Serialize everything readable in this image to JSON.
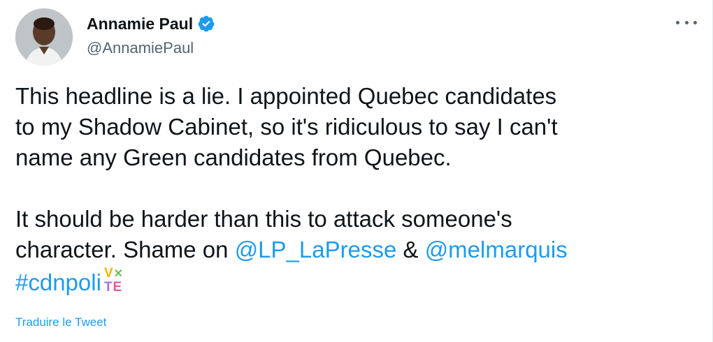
{
  "author": {
    "name": "Annamie Paul",
    "handle": "@AnnamiePaul",
    "verified": true,
    "avatar_icon": "profile-photo"
  },
  "menu": {
    "more_icon": "ellipsis-icon"
  },
  "tweet": {
    "para1_line1": "This headline is a lie. I appointed Quebec candidates",
    "para1_line2": "to my Shadow Cabinet, so it's ridiculous to say I can't",
    "para1_line3": "name any Green candidates from Quebec.",
    "para2_line1": "It should be harder than this to attack someone's",
    "para2_line2_text": "character. Shame on ",
    "mention1": "@LP_LaPresse",
    "amp": " & ",
    "mention2": "@melmarquis",
    "hashtag": "#cdnpoli",
    "vote_emoji": {
      "v": "V",
      "o": "✕",
      "t": "T",
      "e": "E"
    }
  },
  "translate_label": "Traduire le Tweet",
  "colors": {
    "link": "#1d9bf0",
    "verified": "#1d9bf0",
    "text": "#0f1419",
    "secondary": "#536471"
  }
}
